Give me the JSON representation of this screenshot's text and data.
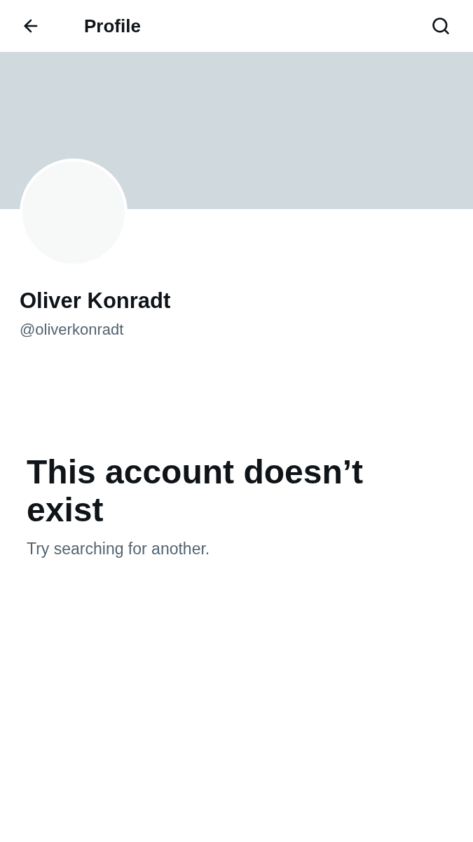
{
  "header": {
    "title": "Profile"
  },
  "profile": {
    "name": "Oliver Konradt",
    "handle": "@oliverkonradt"
  },
  "message": {
    "title": "This account doesn’t exist",
    "subtitle": "Try searching for another."
  }
}
